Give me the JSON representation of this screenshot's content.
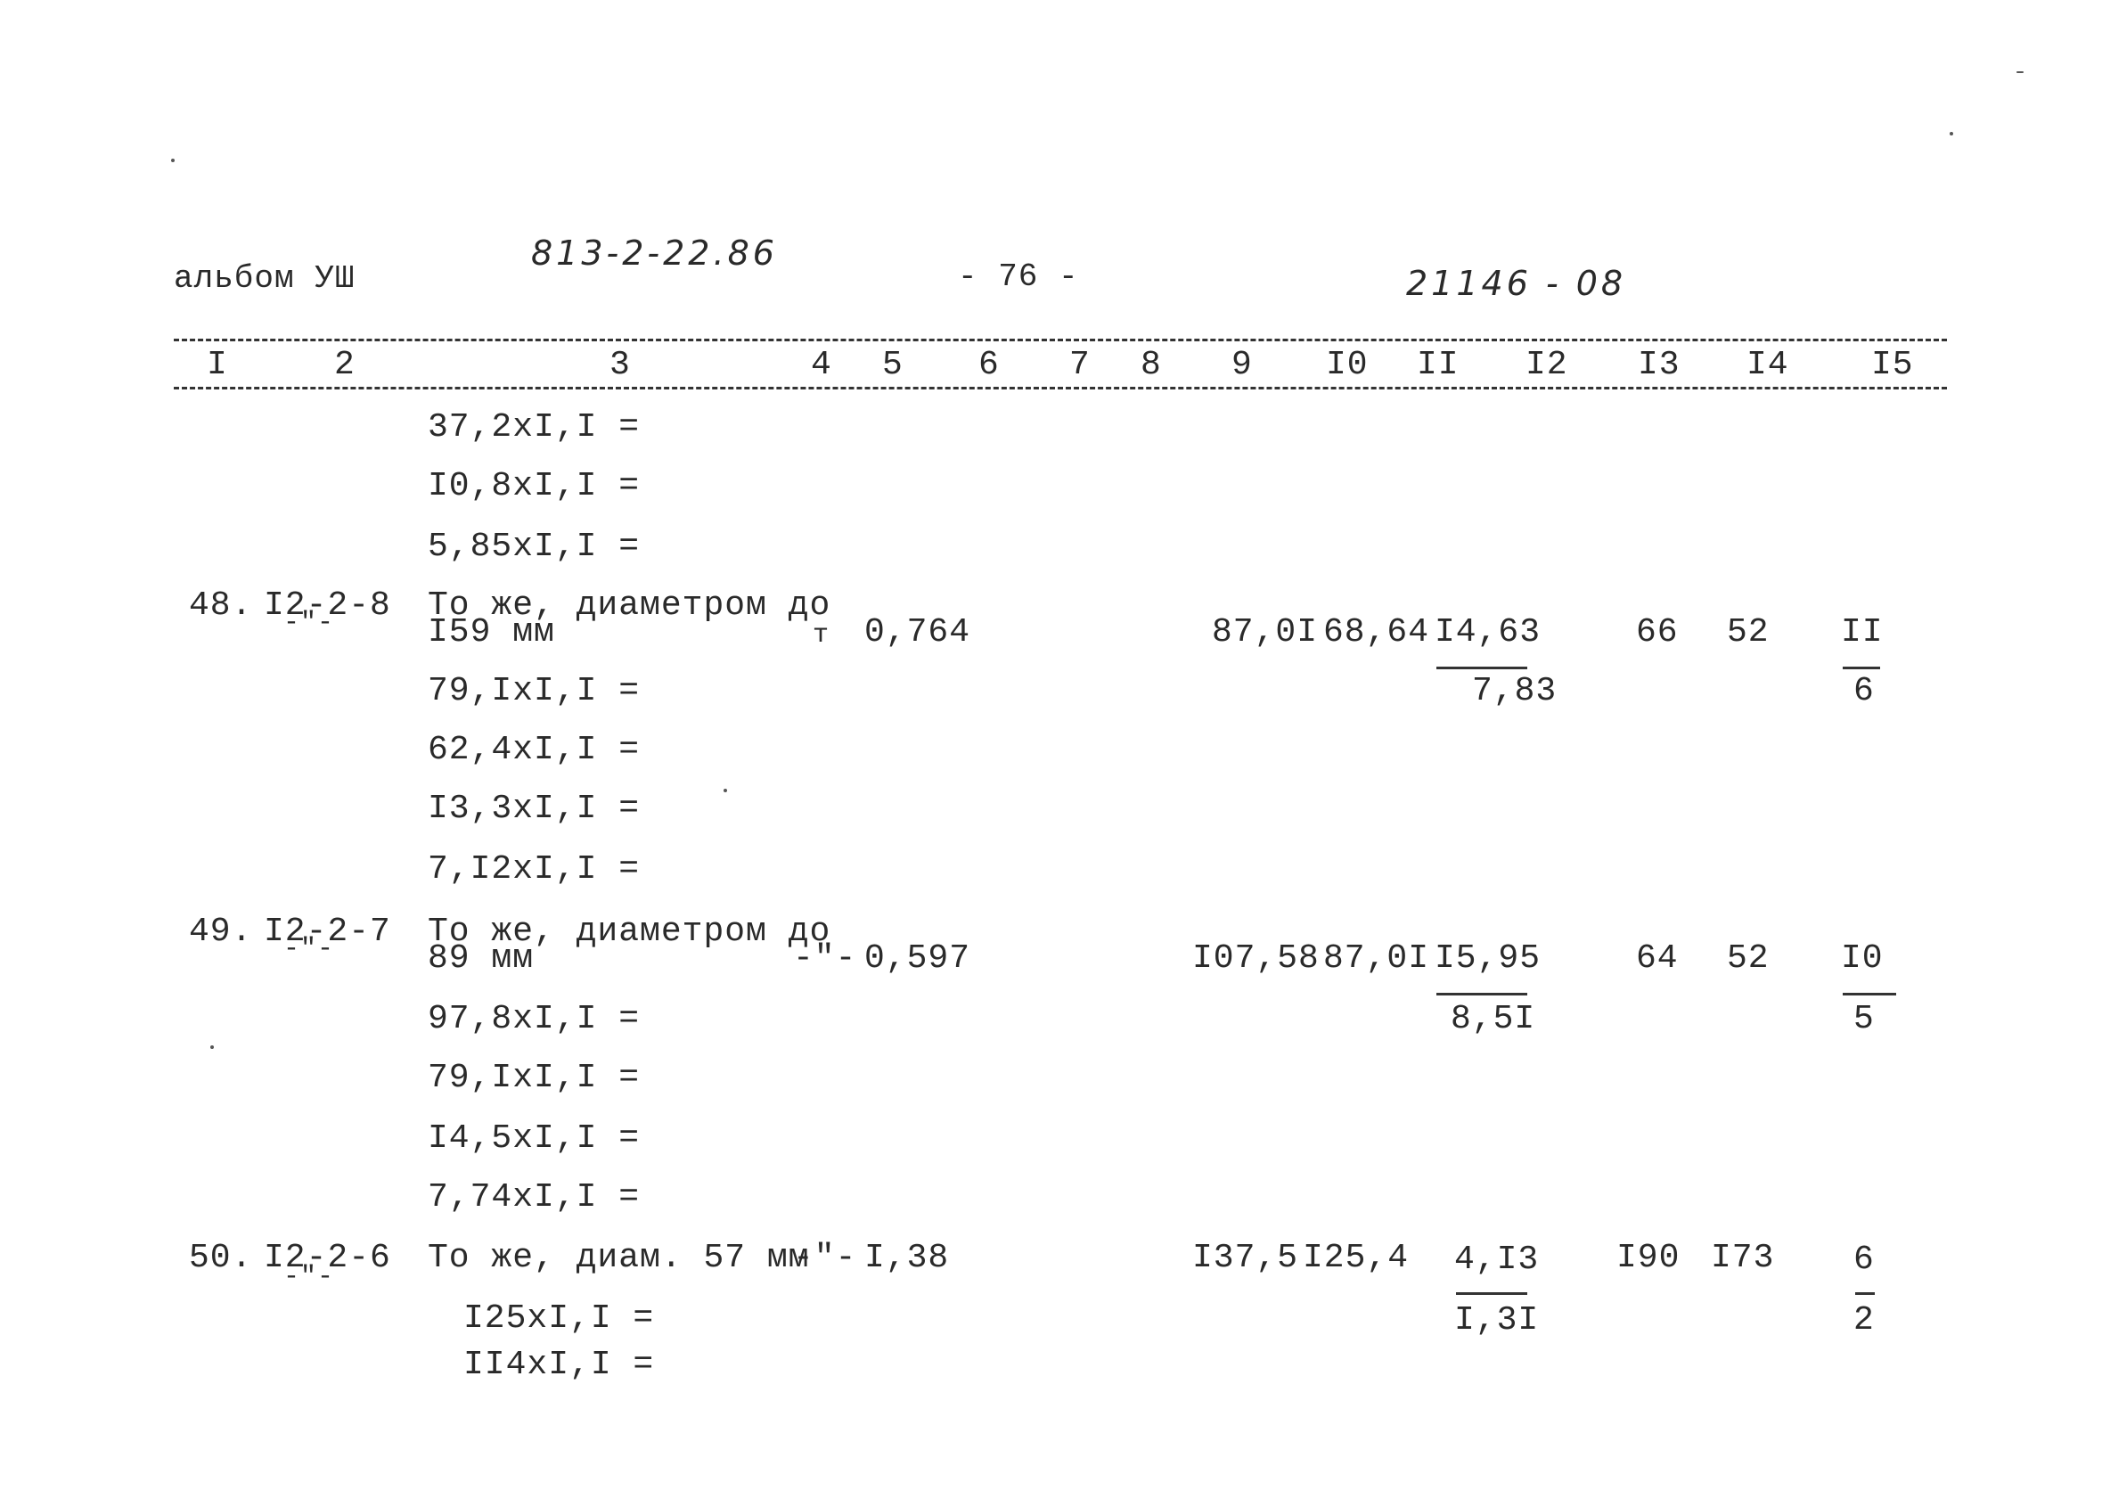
{
  "header": {
    "album": "альбом УШ",
    "doc_code": "813-2-22.86",
    "page": "- 76 -",
    "inventory": "21146 - 08"
  },
  "columns": [
    "I",
    "2",
    "3",
    "4",
    "5",
    "6",
    "7",
    "8",
    "9",
    "I0",
    "II",
    "I2",
    "I3",
    "I4",
    "I5"
  ],
  "rows": [
    {
      "type": "calc",
      "text": "37,2xI,I ="
    },
    {
      "type": "calc",
      "text": "I0,8xI,I ="
    },
    {
      "type": "calc",
      "text": "5,85xI,I ="
    },
    {
      "type": "item",
      "num": "48.",
      "code": "I2-2-8",
      "ditto": "-\"-",
      "desc_line1": "То же, диаметром до",
      "desc_line2": "I59 мм",
      "unit": "т",
      "qty": "0,764",
      "c9": "87,0I",
      "c10": "68,64",
      "c11_top": "I4,63",
      "c11_bottom": "7,83",
      "c13": "66",
      "c14": "52",
      "c15_top": "II",
      "c15_bottom": "6",
      "calcs": [
        "79,IxI,I =",
        "62,4xI,I =",
        "I3,3xI,I =",
        "7,I2xI,I ="
      ]
    },
    {
      "type": "item",
      "num": "49.",
      "code": "I2-2-7",
      "ditto": "-\"-",
      "desc_line1": "То же, диаметром до",
      "desc_line2": "89 мм",
      "unit": "-\"-",
      "qty": "0,597",
      "c9": "I07,58",
      "c10": "87,0I",
      "c11_top": "I5,95",
      "c11_bottom": "8,5I",
      "c13": "64",
      "c14": "52",
      "c15_top": "I0",
      "c15_bottom": "5",
      "calcs": [
        "97,8xI,I =",
        "79,IxI,I =",
        "I4,5xI,I =",
        "7,74xI,I ="
      ]
    },
    {
      "type": "item",
      "num": "50.",
      "code": "I2-2-6",
      "ditto": "-\"-",
      "desc_line1": "То же, диам. 57 мм",
      "unit": "-\"-",
      "qty": "I,38",
      "c9": "I37,5",
      "c10": "I25,4",
      "c11_top": "4,I3",
      "c11_bottom": "I,3I",
      "c13": "I90",
      "c14": "I73",
      "c15_top": "6",
      "c15_bottom": "2",
      "calcs": [
        "I25xI,I =",
        "II4xI,I ="
      ]
    }
  ]
}
